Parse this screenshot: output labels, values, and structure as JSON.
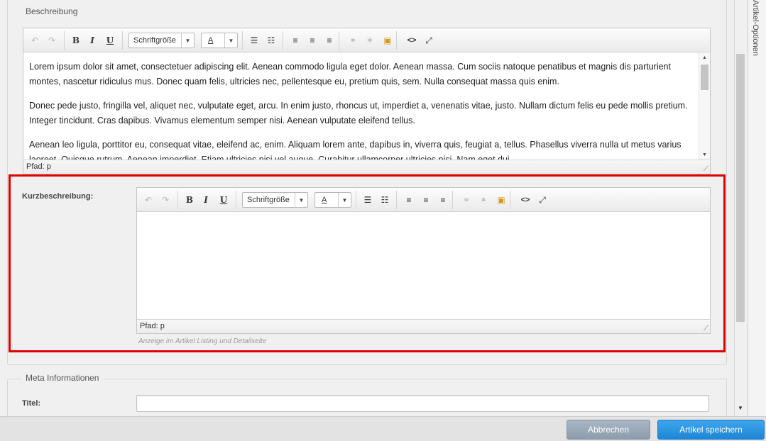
{
  "description_section": {
    "legend": "Beschreibung",
    "editor": {
      "fontsize_label": "Schriftgröße",
      "color_label": "A",
      "paragraphs": [
        "Lorem ipsum dolor sit amet, consectetuer adipiscing elit. Aenean commodo ligula eget dolor. Aenean massa. Cum sociis natoque penatibus et magnis dis parturient montes, nascetur ridiculus mus. Donec quam felis, ultricies nec, pellentesque eu, pretium quis, sem. Nulla consequat massa quis enim.",
        "Donec pede justo, fringilla vel, aliquet nec, vulputate eget, arcu. In enim justo, rhoncus ut, imperdiet a, venenatis vitae, justo. Nullam dictum felis eu pede mollis pretium. Integer tincidunt. Cras dapibus. Vivamus elementum semper nisi. Aenean vulputate eleifend tellus.",
        "Aenean leo ligula, porttitor eu, consequat vitae, eleifend ac, enim. Aliquam lorem ante, dapibus in, viverra quis, feugiat a, tellus. Phasellus viverra nulla ut metus varius laoreet. Quisque rutrum. Aenean imperdiet. Etiam ultricies nisi vel augue. Curabitur ullamcorper ultricies nisi. Nam eget dui."
      ],
      "path": "Pfad: p"
    }
  },
  "short_description": {
    "label": "Kurzbeschreibung:",
    "editor": {
      "fontsize_label": "Schriftgröße",
      "color_label": "A",
      "path": "Pfad: p"
    },
    "help": "Anzeige im Artikel Listing und Detailseite"
  },
  "meta_section": {
    "legend": "Meta Informationen",
    "title_label": "Titel:",
    "title_value": ""
  },
  "side_tab": {
    "label": "Artikel-Optionen"
  },
  "footer": {
    "cancel_label": "Abbrechen",
    "save_label": "Artikel speichern"
  },
  "icons": {
    "undo": "↶",
    "redo": "↷",
    "bold": "B",
    "italic": "I",
    "underline": "U",
    "bullet_list": "☰",
    "numbered_list": "☷",
    "align_left": "≡",
    "align_center": "≡",
    "align_right": "≡",
    "link": "⚭",
    "unlink": "✶",
    "media": "▣",
    "source": "<>",
    "fullscreen": "⤢"
  },
  "colors": {
    "highlight": "#e00000",
    "save_button": "#2a94de",
    "cancel_button": "#9aa8b8"
  }
}
